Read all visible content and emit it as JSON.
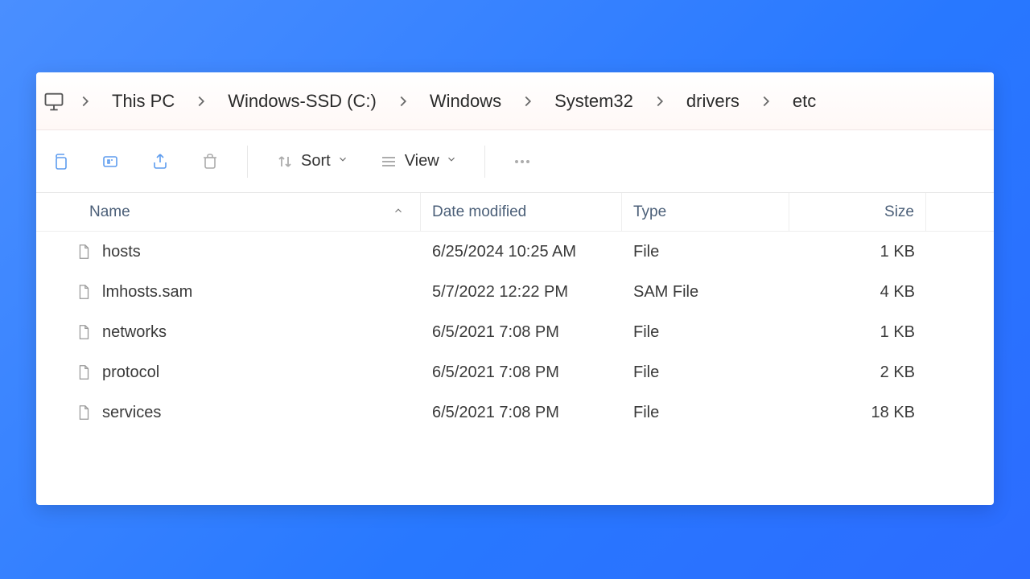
{
  "breadcrumb": [
    {
      "label": "This PC"
    },
    {
      "label": "Windows-SSD (C:)"
    },
    {
      "label": "Windows"
    },
    {
      "label": "System32"
    },
    {
      "label": "drivers"
    },
    {
      "label": "etc"
    }
  ],
  "toolbar": {
    "sort_label": "Sort",
    "view_label": "View"
  },
  "columns": {
    "name": "Name",
    "date": "Date modified",
    "type": "Type",
    "size": "Size"
  },
  "sort": {
    "column": "name",
    "dir": "asc"
  },
  "files": [
    {
      "name": "hosts",
      "date": "6/25/2024 10:25 AM",
      "type": "File",
      "size": "1 KB"
    },
    {
      "name": "lmhosts.sam",
      "date": "5/7/2022 12:22 PM",
      "type": "SAM File",
      "size": "4 KB"
    },
    {
      "name": "networks",
      "date": "6/5/2021 7:08 PM",
      "type": "File",
      "size": "1 KB"
    },
    {
      "name": "protocol",
      "date": "6/5/2021 7:08 PM",
      "type": "File",
      "size": "2 KB"
    },
    {
      "name": "services",
      "date": "6/5/2021 7:08 PM",
      "type": "File",
      "size": "18 KB"
    }
  ]
}
